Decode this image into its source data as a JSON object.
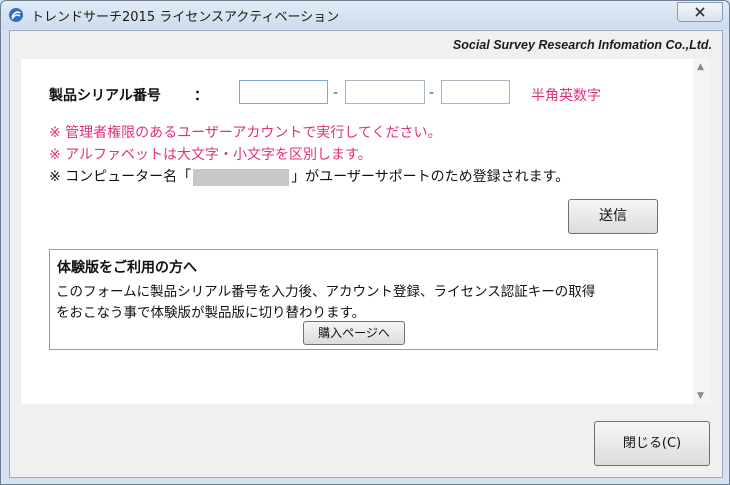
{
  "window": {
    "title": "トレンドサーチ2015 ライセンスアクティベーション",
    "close_glyph": "✕"
  },
  "header": {
    "company": "Social Survey Research Infomation Co.,Ltd."
  },
  "form": {
    "serial_label": "製品シリアル番号",
    "colon": "：",
    "serial_fields": [
      {
        "value": "",
        "placeholder": ""
      },
      {
        "value": "",
        "placeholder": ""
      },
      {
        "value": "",
        "placeholder": ""
      }
    ],
    "separator": "-",
    "hint": "半角英数字",
    "notes": {
      "admin": "※ 管理者権限のあるユーザーアカウントで実行してください。",
      "case": "※ アルファベットは大文字・小文字を区別します。",
      "computer_prefix": "※ コンピューター名「",
      "computer_suffix": "」がユーザーサポートのため登録されます。"
    },
    "send_label": "送信"
  },
  "trial": {
    "title": "体験版をご利用の方へ",
    "line1": "このフォームに製品シリアル番号を入力後、アカウント登録、ライセンス認証キーの取得",
    "line2": "をおこなう事で体験版が製品版に切り替わります。",
    "buy_label": "購入ページへ"
  },
  "footer": {
    "close_label": "閉じる(C)"
  },
  "scrollbar": {
    "up_glyph": "▲",
    "down_glyph": "▼"
  },
  "colors": {
    "accent_pink": "#e0307c",
    "title_bar": "#d6e2f0"
  },
  "icons": {
    "app": "app-logo-icon",
    "close": "close-icon"
  }
}
